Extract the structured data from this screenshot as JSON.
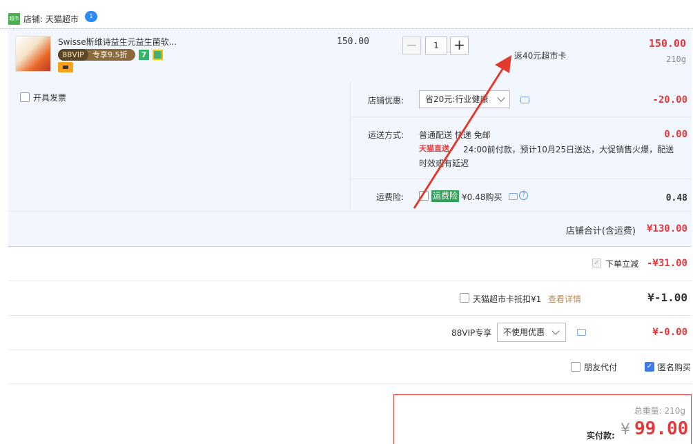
{
  "shop": {
    "name": "店铺: 天猫超市",
    "logo_text": "超市",
    "chat_badge": "1"
  },
  "item": {
    "title": "Swisse斯维诗益生元益生菌软...",
    "vip_tag": "88VIP",
    "vip_discount": "专享9.5折",
    "badge_seven": "7",
    "unit_price": "150.00",
    "quantity": "1",
    "minus": "−",
    "plus": "+",
    "cashback": "返40元超市卡",
    "total": "150.00",
    "weight": "210g"
  },
  "options": {
    "invoice_label": "开具发票",
    "discount_label": "店铺优惠:",
    "discount_value": "省20元:行业健康",
    "discount_amount": "-20.00",
    "shipping_label": "运送方式:",
    "shipping_method": "普通配送 快递 免邮",
    "shipping_logo": "天猫直送",
    "shipping_detail": "24:00前付款，预计10月25日送达，大促销售火爆，配送",
    "shipping_detail2": "时效或有延迟",
    "shipping_amount": "0.00",
    "insurance_label": "运费险:",
    "insurance_tag": "运费险",
    "insurance_price": "¥0.48购买",
    "insurance_help": "?",
    "insurance_amount": "0.48",
    "store_total_label": "店铺合计(含运费)",
    "store_total_amount": "¥130.00"
  },
  "summary": {
    "instant_label": "下单立减",
    "instant_check": "✓",
    "instant_amount": "-¥31.00",
    "card_label": "天猫超市卡抵扣¥1",
    "card_link": "查看详情",
    "card_amount": "¥-1.00",
    "vip_label": "88VIP专享",
    "vip_select": "不使用优惠",
    "vip_amount": "¥-0.00",
    "friend_label": "朋友代付",
    "anon_label": "匿名购买",
    "anon_check": "✓"
  },
  "pay": {
    "weight_total": "总重量: 210g",
    "label": "实付款:",
    "currency": "¥",
    "amount": "99.00"
  },
  "colors": {
    "accent_red": "#e4393c",
    "row_bg": "#f2f7ff",
    "arrow": "#e23b2e"
  }
}
